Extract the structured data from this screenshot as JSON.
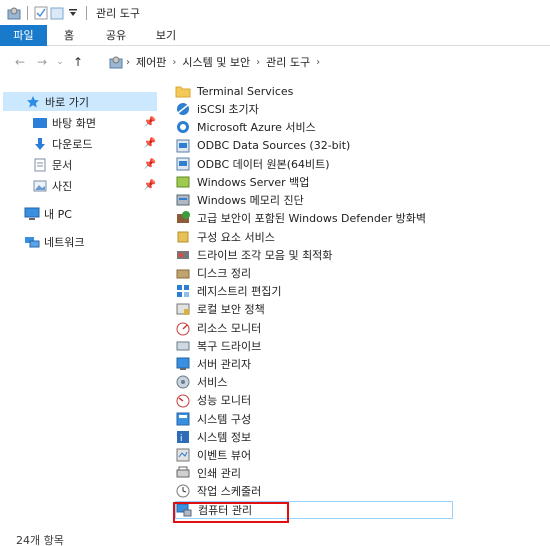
{
  "window": {
    "title": "관리 도구"
  },
  "ribbon": {
    "tabs": [
      "파일",
      "홈",
      "공유",
      "보기"
    ]
  },
  "address": {
    "crumbs": [
      "제어판",
      "시스템 및 보안",
      "관리 도구"
    ]
  },
  "nav": {
    "quick_access": "바로 가기",
    "pinned": [
      "바탕 화면",
      "다운로드",
      "문서",
      "사진"
    ],
    "this_pc": "내 PC",
    "network": "네트워크"
  },
  "items": [
    "Terminal Services",
    "iSCSI 초기자",
    "Microsoft Azure 서비스",
    "ODBC Data Sources (32-bit)",
    "ODBC 데이터 원본(64비트)",
    "Windows Server 백업",
    "Windows 메모리 진단",
    "고급 보안이 포함된 Windows Defender 방화벽",
    "구성 요소 서비스",
    "드라이브 조각 모음 및 최적화",
    "디스크 정리",
    "레지스트리 편집기",
    "로컬 보안 정책",
    "리소스 모니터",
    "복구 드라이브",
    "서버 관리자",
    "서비스",
    "성능 모니터",
    "시스템 구성",
    "시스템 정보",
    "이벤트 뷰어",
    "인쇄 관리",
    "작업 스케줄러",
    "컴퓨터 관리"
  ],
  "status": {
    "count": "24개 항목"
  },
  "colors": {
    "accent": "#1979ca",
    "selection": "#cce8ff",
    "highlight": "#e01010"
  }
}
